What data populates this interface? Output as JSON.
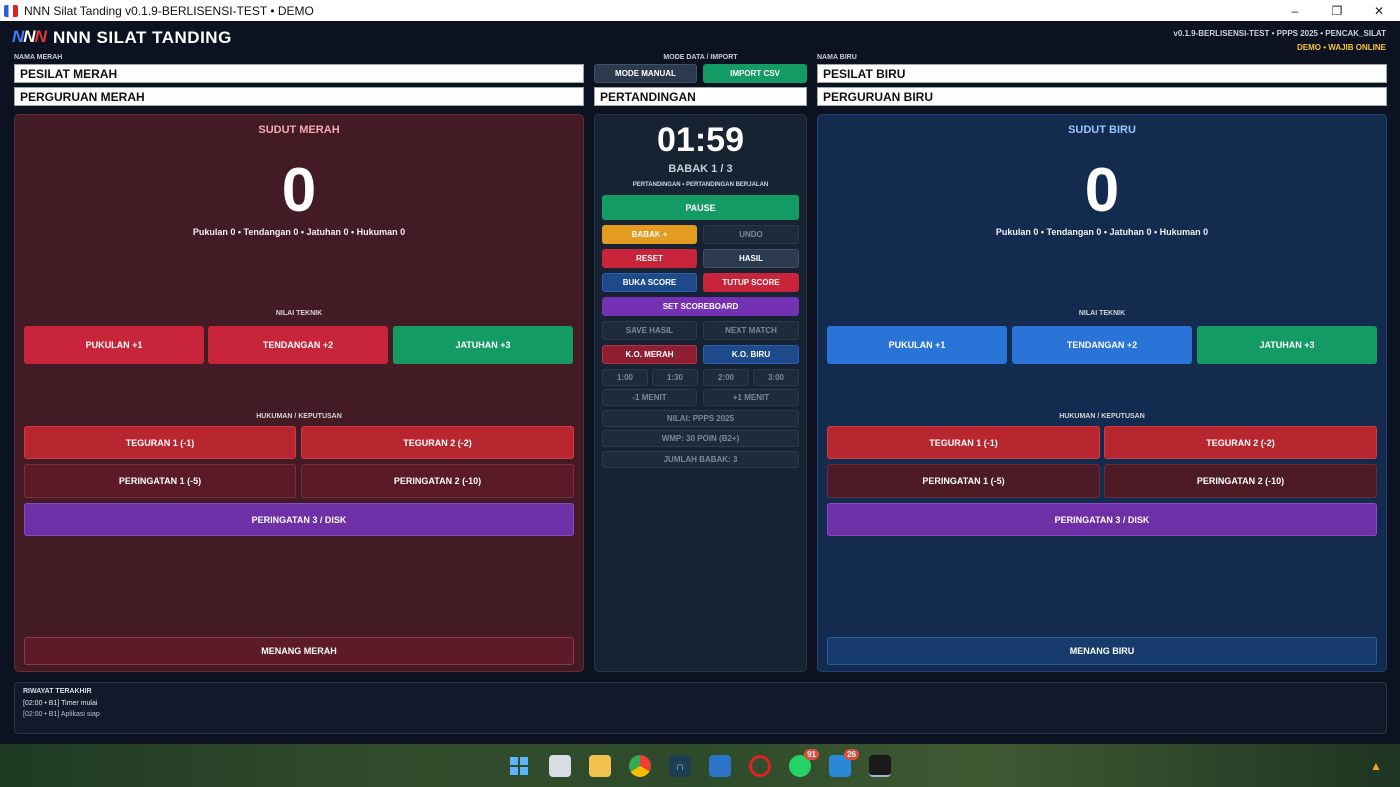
{
  "window": {
    "title": "NNN Silat Tanding v0.1.9-BERLISENSI-TEST • DEMO",
    "minimize": "–",
    "maximize": "❐",
    "close": "✕"
  },
  "header": {
    "logo_letters": [
      "N",
      "N",
      "N"
    ],
    "app_title": "NNN SILAT TANDING",
    "version_info": "v0.1.9-BERLISENSI-TEST • PPPS 2025 • PENCAK_SILAT",
    "license_status": "DEMO • WAJIB ONLINE"
  },
  "top_fields": {
    "red_name_label": "NAMA MERAH",
    "red_name": "PESILAT MERAH",
    "red_school": "PERGURUAN MERAH",
    "mode_label": "MODE DATA / IMPORT",
    "mode_manual": "MODE MANUAL",
    "import_csv": "IMPORT CSV",
    "match_name": "PERTANDINGAN",
    "blue_name_label": "NAMA BIRU",
    "blue_name": "PESILAT BIRU",
    "blue_school": "PERGURUAN BIRU"
  },
  "red": {
    "title": "SUDUT MERAH",
    "score": "0",
    "stats": "Pukulan 0  •  Tendangan 0  •  Jatuhan 0  •  Hukuman 0",
    "tech_label": "NILAI TEKNIK",
    "pukulan": "PUKULAN +1",
    "tendangan": "TENDANGAN +2",
    "jatuhan": "JATUHAN +3",
    "penalty_label": "HUKUMAN / KEPUTUSAN",
    "teguran1": "TEGURAN 1  (-1)",
    "teguran2": "TEGURAN 2  (-2)",
    "peringatan1": "PERINGATAN 1  (-5)",
    "peringatan2": "PERINGATAN 2  (-10)",
    "peringatan3": "PERINGATAN 3 / DISK",
    "win": "MENANG MERAH"
  },
  "blue": {
    "title": "SUDUT BIRU",
    "score": "0",
    "stats": "Pukulan 0  •  Tendangan 0  •  Jatuhan 0  •  Hukuman 0",
    "tech_label": "NILAI TEKNIK",
    "pukulan": "PUKULAN +1",
    "tendangan": "TENDANGAN +2",
    "jatuhan": "JATUHAN +3",
    "penalty_label": "HUKUMAN / KEPUTUSAN",
    "teguran1": "TEGURAN 1  (-1)",
    "teguran2": "TEGURAN 2  (-2)",
    "peringatan1": "PERINGATAN 1  (-5)",
    "peringatan2": "PERINGATAN 2  (-10)",
    "peringatan3": "PERINGATAN 3 / DISK",
    "win": "MENANG BIRU"
  },
  "control": {
    "timer": "01:59",
    "babak": "BABAK 1 / 3",
    "status": "PERTANDINGAN  •  PERTANDINGAN BERJALAN",
    "pause": "PAUSE",
    "babak_plus": "BABAK +",
    "undo": "UNDO",
    "reset": "RESET",
    "hasil": "HASIL",
    "buka_score": "BUKA SCORE",
    "tutup_score": "TUTUP SCORE",
    "set_scoreboard": "SET SCOREBOARD",
    "save_hasil": "SAVE HASIL",
    "next_match": "NEXT MATCH",
    "ko_merah": "K.O. MERAH",
    "ko_biru": "K.O. BIRU",
    "durations": [
      "1:00",
      "1:30",
      "2:00",
      "3:00"
    ],
    "minus_menit": "-1 MENIT",
    "plus_menit": "+1 MENIT",
    "nilai": "NILAI: PPPS 2025",
    "wmp": "WMP: 30 POIN (B2+)",
    "jumlah_babak": "JUMLAH BABAK: 3"
  },
  "history": {
    "title": "RIWAYAT TERAKHIR",
    "entries": [
      "[02:00 • B1] Timer mulai",
      "[02:00 • B1] Aplikasi siap"
    ]
  },
  "taskbar": {
    "whatsapp_badge": "91",
    "app_badge": "26"
  }
}
